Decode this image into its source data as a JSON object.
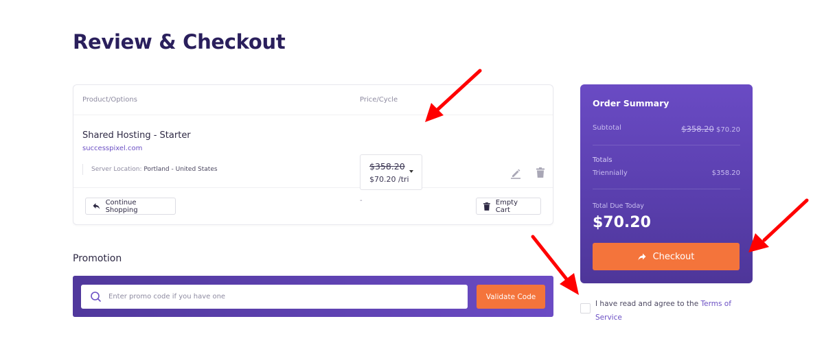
{
  "page": {
    "title": "Review & Checkout"
  },
  "cart": {
    "columns": {
      "product": "Product/Options",
      "price": "Price/Cycle"
    },
    "items": [
      {
        "name": "Shared Hosting - Starter",
        "domain": "successpixel.com",
        "option_label": "Server Location:",
        "option_value": "Portland - United States",
        "price_original": "$358.20",
        "price_current": "$70.20 /tri",
        "option_price": "-"
      }
    ],
    "continue_label": "Continue Shopping",
    "empty_label": "Empty Cart"
  },
  "promotion": {
    "title": "Promotion",
    "placeholder": "Enter promo code if you have one",
    "value": "",
    "validate_label": "Validate Code"
  },
  "summary": {
    "title": "Order Summary",
    "subtotal_label": "Subtotal",
    "subtotal_original": "$358.20",
    "subtotal_current": "$70.20",
    "totals_label": "Totals",
    "cycle_label": "Triennially",
    "cycle_amount": "$358.20",
    "total_due_label": "Total Due Today",
    "total_due_amount": "$70.20",
    "checkout_label": "Checkout"
  },
  "terms": {
    "text": "I have read and agree to the ",
    "link": "Terms of Service",
    "checked": false
  },
  "colors": {
    "brand_purple": "#6a4bc4",
    "accent_orange": "#f4743b",
    "title_navy": "#2a1f5c",
    "annotation_red": "#ff0000"
  }
}
